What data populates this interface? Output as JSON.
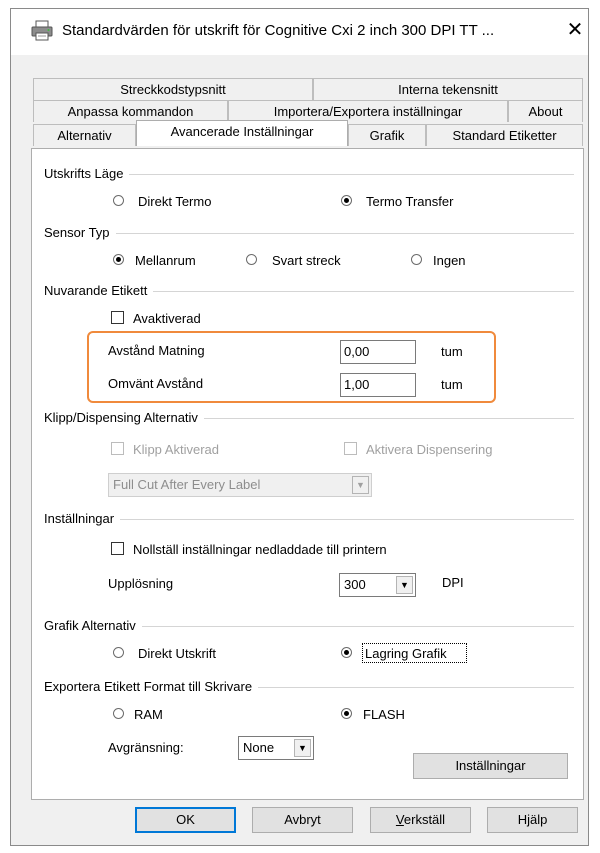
{
  "window": {
    "title": "Standardvärden för utskrift för Cognitive Cxi 2 inch 300 DPI TT ...",
    "close_glyph": "✕"
  },
  "tabs": {
    "row1": [
      "Streckkodstypsnitt",
      "Interna tekensnitt"
    ],
    "row2": [
      "Anpassa kommandon",
      "Importera/Exportera inställningar",
      "About"
    ],
    "row3": [
      "Alternativ",
      "Avancerade Inställningar",
      "Grafik",
      "Standard Etiketter"
    ],
    "active": "Avancerade Inställningar"
  },
  "utskriftslage": {
    "title": "Utskrifts Läge",
    "option1": "Direkt Termo",
    "option2": "Termo Transfer",
    "selected": "Termo Transfer"
  },
  "sensor": {
    "title": "Sensor Typ",
    "option1": "Mellanrum",
    "option2": "Svart streck",
    "option3": "Ingen",
    "selected": "Mellanrum"
  },
  "etikett": {
    "title": "Nuvarande Etikett",
    "deactivated_label": "Avaktiverad",
    "deactivated_checked": false,
    "feed_label": "Avstånd Matning",
    "feed_value": "0,00",
    "feed_unit": "tum",
    "reverse_label": "Omvänt Avstånd",
    "reverse_value": "1,00",
    "reverse_unit": "tum"
  },
  "klipp": {
    "title": "Klipp/Dispensing Alternativ",
    "cut_label": "Klipp Aktiverad",
    "dispense_label": "Aktivera Dispensering",
    "cut_mode": "Full Cut After Every Label"
  },
  "installningar": {
    "title": "Inställningar",
    "reset_label": "Nollställ inställningar nedladdade till printern",
    "reset_checked": false,
    "resolution_label": "Upplösning",
    "resolution_value": "300",
    "resolution_unit": "DPI"
  },
  "grafik": {
    "title": "Grafik Alternativ",
    "option1": "Direkt Utskrift",
    "option2": "Lagring Grafik",
    "selected": "Lagring Grafik"
  },
  "export": {
    "title": "Exportera Etikett Format till Skrivare",
    "option1": "RAM",
    "option2": "FLASH",
    "selected": "FLASH",
    "delimiter_label": "Avgränsning:",
    "delimiter_value": "None",
    "settings_button": "Inställningar"
  },
  "buttons": {
    "ok": "OK",
    "cancel": "Avbryt",
    "apply_first": "V",
    "apply_rest": "erkställ",
    "help": "Hjälp"
  },
  "colors": {
    "highlight": "#f08a3c",
    "default_button_border": "#0078d7"
  },
  "icons": [
    "printer-icon",
    "close-icon",
    "chevron-down-icon"
  ]
}
